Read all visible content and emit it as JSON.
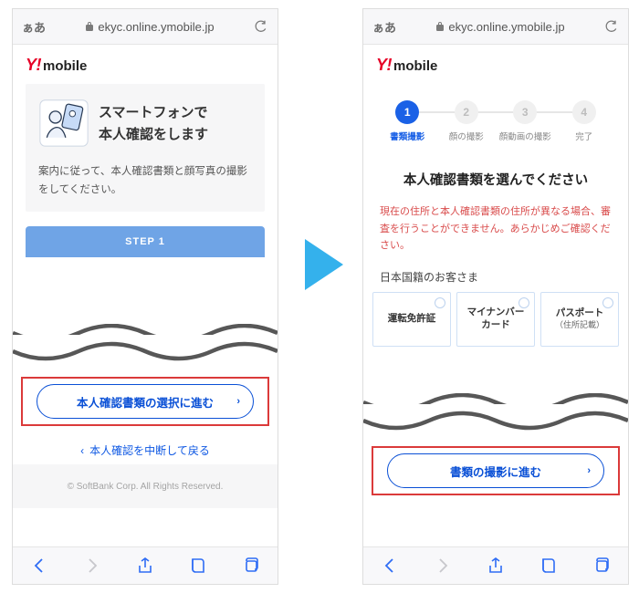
{
  "browser": {
    "aa": "ぁあ",
    "lock": true,
    "url": "ekyc.online.ymobile.jp"
  },
  "brand": {
    "y": "Y!",
    "m": "mobile"
  },
  "left": {
    "introTitle": "スマートフォンで\n本人確認をします",
    "introDesc": "案内に従って、本人確認書類と顔写真の撮影をしてください。",
    "step1": "STEP 1",
    "primaryBtn": "本人確認書類の選択に進む",
    "secondaryLink": "本人確認を中断して戻る",
    "footer": "© SoftBank Corp. All Rights Reserved."
  },
  "right": {
    "steps": [
      {
        "num": "1",
        "label": "書類撮影",
        "active": true
      },
      {
        "num": "2",
        "label": "顔の撮影",
        "active": false
      },
      {
        "num": "3",
        "label": "顔動画の撮影",
        "active": false
      },
      {
        "num": "4",
        "label": "完了",
        "active": false
      }
    ],
    "title": "本人確認書類を選んでください",
    "notice": "現在の住所と本人確認書類の住所が異なる場合、審査を行うことができません。あらかじめご確認ください。",
    "subhead": "日本国籍のお客さま",
    "docs": [
      {
        "label": "運転免許証",
        "sub": ""
      },
      {
        "label": "マイナンバー\nカード",
        "sub": ""
      },
      {
        "label": "パスポート",
        "sub": "（住所記載）"
      }
    ],
    "primaryBtn": "書類の撮影に進む"
  }
}
